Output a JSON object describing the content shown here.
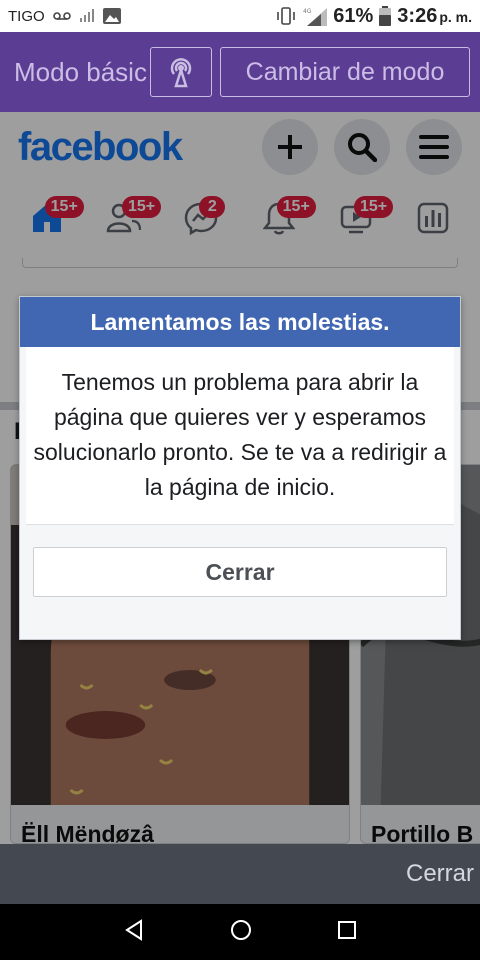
{
  "status_bar": {
    "carrier": "TIGO",
    "signal_label": "4G",
    "battery_percent": "61%",
    "time": "3:26",
    "time_suffix": "p. m."
  },
  "mode_banner": {
    "mode_text": "Modo básico",
    "change_button": "Cambiar de modo"
  },
  "header": {
    "logo": "facebook"
  },
  "nav": {
    "badges": [
      "15+",
      "15+",
      "2",
      "15+",
      "15+"
    ]
  },
  "feed": {
    "section_letter": "P",
    "stories": [
      {
        "name": "Ëll Mëndøzâ"
      },
      {
        "name": "Portillo B"
      }
    ]
  },
  "dialog": {
    "title": "Lamentamos las molestias.",
    "message": "Tenemos un problema para abrir la página que quieres ver y esperamos solucionarlo pronto. Se te va a redirigir a la página de inicio.",
    "button": "Cerrar"
  },
  "bottom_bar": {
    "close_label": "Cerrar"
  },
  "colors": {
    "brand_blue": "#1877f2",
    "dialog_title_bg": "#4267b2",
    "banner_purple": "#5b3d93",
    "badge_red": "#e41e3f"
  }
}
